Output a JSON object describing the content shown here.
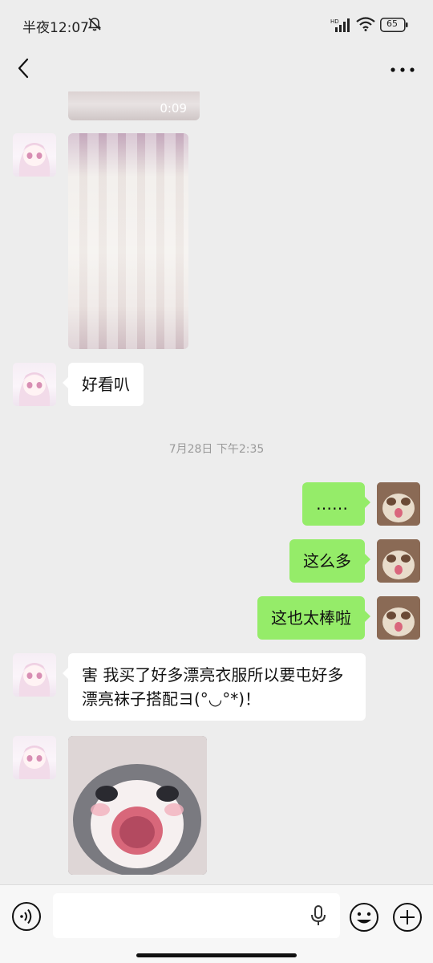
{
  "status_bar": {
    "time": "半夜12:07",
    "battery": "65",
    "icons": [
      "mute-bell-icon",
      "hd-signal-icon",
      "wifi-icon",
      "battery-icon"
    ]
  },
  "nav": {
    "back_icon": "chevron-left-icon",
    "more_icon": "more-dots-icon"
  },
  "messages": [
    {
      "side": "left",
      "type": "video",
      "duration": "0:09"
    },
    {
      "side": "left",
      "type": "image",
      "content": "socks photo"
    },
    {
      "side": "left",
      "type": "text",
      "text": "好看叭"
    },
    {
      "type": "timestamp",
      "text": "7月28日 下午2:35"
    },
    {
      "side": "right",
      "type": "text",
      "text": "……"
    },
    {
      "side": "right",
      "type": "text",
      "text": "这么多"
    },
    {
      "side": "right",
      "type": "text",
      "text": "这也太棒啦"
    },
    {
      "side": "left",
      "type": "text",
      "text": "害 我买了好多漂亮衣服所以要屯好多漂亮袜子搭配ヨ(°◡°*)！"
    },
    {
      "side": "left",
      "type": "image",
      "content": "cat sticker"
    }
  ],
  "input_bar": {
    "message_value": "",
    "icons": [
      "voice-icon",
      "mic-icon",
      "emoji-icon",
      "plus-icon"
    ]
  },
  "colors": {
    "background": "#ededed",
    "bubble_sent": "#95ec69",
    "bubble_received": "#ffffff",
    "timestamp_text": "#9a9a9a"
  }
}
